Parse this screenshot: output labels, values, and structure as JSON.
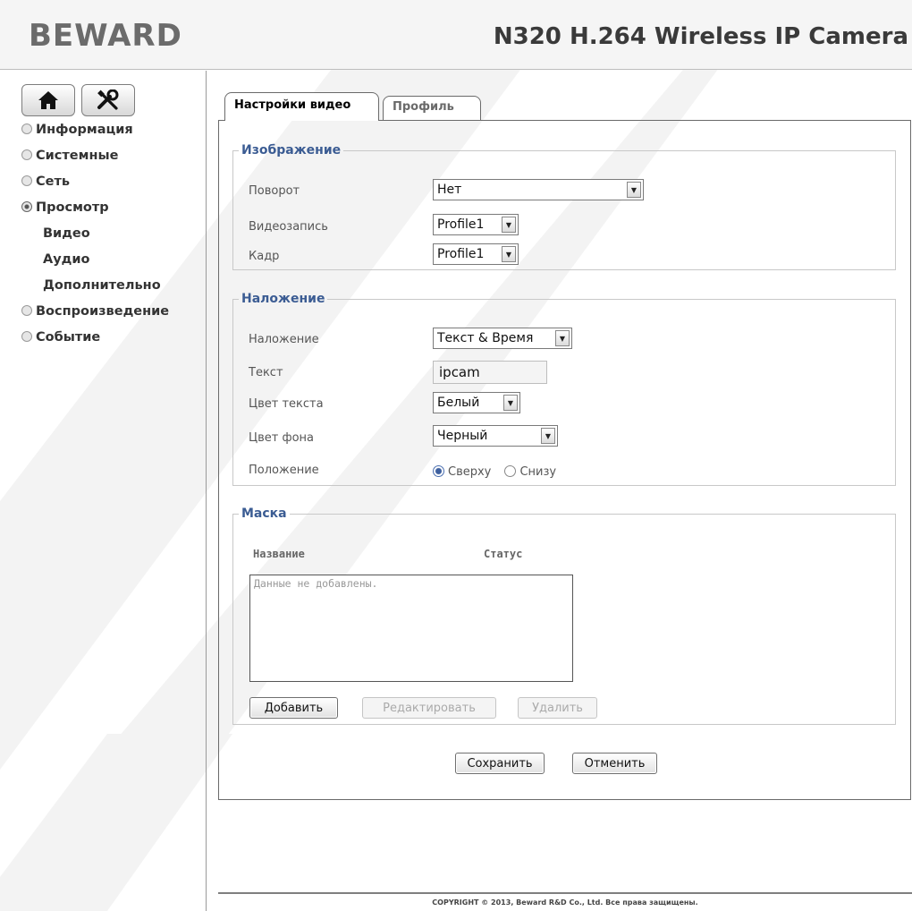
{
  "header": {
    "logo": "BEWARD",
    "model": "N320 H.264 Wireless IP Camera"
  },
  "sidebar": {
    "home_icon": "home-icon",
    "tools_icon": "tools-icon",
    "items": [
      {
        "label": "Информация"
      },
      {
        "label": "Системные"
      },
      {
        "label": "Сеть"
      },
      {
        "label": "Просмотр",
        "open": true,
        "children": [
          {
            "label": "Видео"
          },
          {
            "label": "Аудио"
          },
          {
            "label": "Дополнительно"
          }
        ]
      },
      {
        "label": "Воспроизведение"
      },
      {
        "label": "Событие"
      }
    ]
  },
  "tabs": {
    "video_settings": "Настройки видео",
    "profile": "Профиль"
  },
  "image_group": {
    "legend": "Изображение",
    "rotation_label": "Поворот",
    "rotation_value": "Нет",
    "recording_label": "Видеозапись",
    "recording_value": "Profile1",
    "frame_label": "Кадр",
    "frame_value": "Profile1"
  },
  "overlay_group": {
    "legend": "Наложение",
    "overlay_label": "Наложение",
    "overlay_value": "Текст & Время",
    "text_label": "Текст",
    "text_value": "ipcam",
    "text_color_label": "Цвет текста",
    "text_color_value": "Белый",
    "bg_color_label": "Цвет фона",
    "bg_color_value": "Черный",
    "position_label": "Положение",
    "position_top": "Сверху",
    "position_bottom": "Снизу",
    "position_selected": "Сверху"
  },
  "mask_group": {
    "legend": "Маска",
    "col_name": "Название",
    "col_status": "Статус",
    "empty_text": "Данные не добавлены.",
    "add_button": "Добавить",
    "edit_button": "Редактировать",
    "delete_button": "Удалить"
  },
  "actions": {
    "save": "Сохранить",
    "cancel": "Отменить"
  },
  "footer": {
    "copyright": "COPYRIGHT © 2013, Beward R&D Co., Ltd. Все права защищены."
  },
  "colors": {
    "legend": "#3b5c93",
    "watermark": "#f2f2f2"
  }
}
